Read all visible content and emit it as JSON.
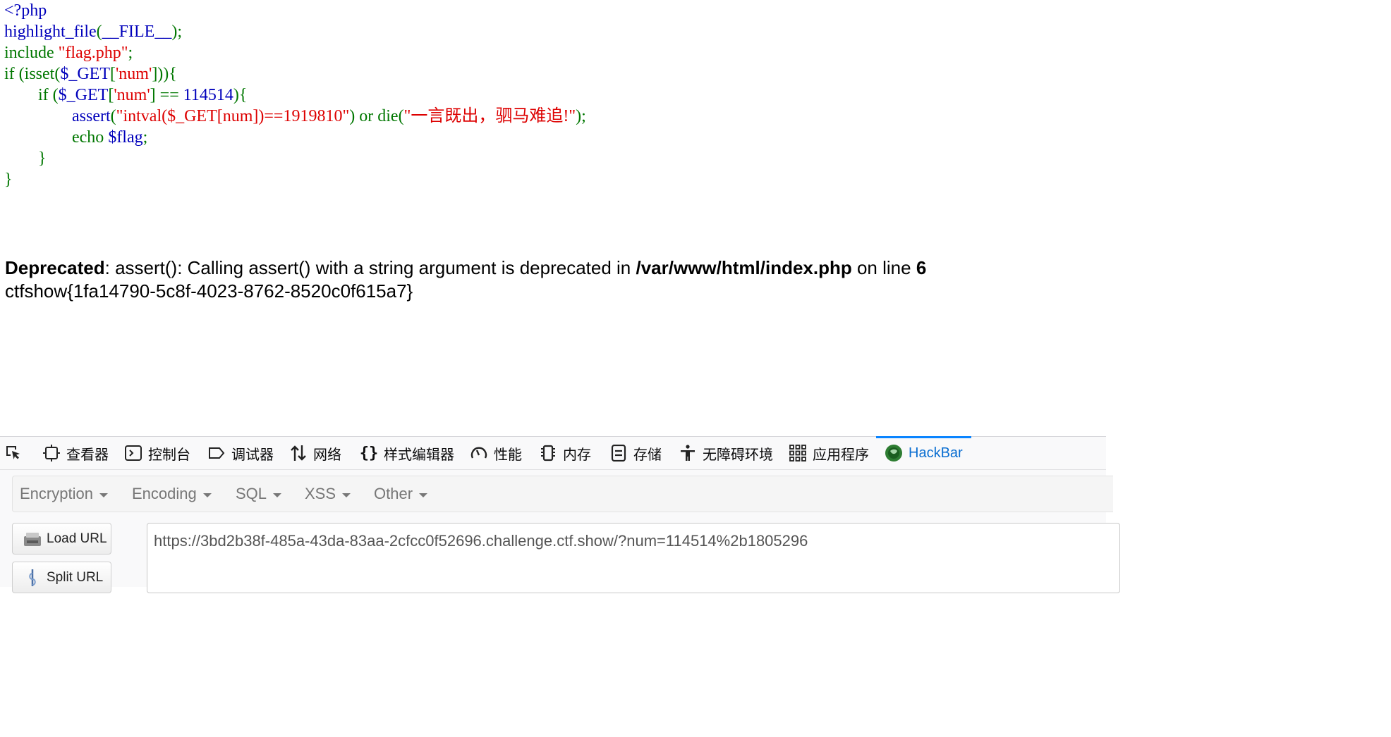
{
  "source_code": {
    "lines": [
      [
        {
          "t": "<?php",
          "c": "d"
        }
      ],
      [
        {
          "t": "highlight_file",
          "c": "d"
        },
        {
          "t": "(",
          "c": "k"
        },
        {
          "t": "__FILE__",
          "c": "d"
        },
        {
          "t": ");",
          "c": "k"
        }
      ],
      [
        {
          "t": "include ",
          "c": "k"
        },
        {
          "t": "\"flag.php\"",
          "c": "s"
        },
        {
          "t": ";",
          "c": "k"
        }
      ],
      [
        {
          "t": "if ",
          "c": "k"
        },
        {
          "t": "(isset(",
          "c": "k"
        },
        {
          "t": "$_GET",
          "c": "d"
        },
        {
          "t": "[",
          "c": "k"
        },
        {
          "t": "'num'",
          "c": "s"
        },
        {
          "t": "])){",
          "c": "k"
        }
      ],
      [
        {
          "t": "        if ",
          "c": "k"
        },
        {
          "t": "(",
          "c": "k"
        },
        {
          "t": "$_GET",
          "c": "d"
        },
        {
          "t": "[",
          "c": "k"
        },
        {
          "t": "'num'",
          "c": "s"
        },
        {
          "t": "] ",
          "c": "k"
        },
        {
          "t": "== ",
          "c": "k"
        },
        {
          "t": "114514",
          "c": "d"
        },
        {
          "t": "){",
          "c": "k"
        }
      ],
      [
        {
          "t": "                ",
          "c": "k"
        },
        {
          "t": "assert",
          "c": "d"
        },
        {
          "t": "(",
          "c": "k"
        },
        {
          "t": "\"intval($_GET[num])==1919810\"",
          "c": "s"
        },
        {
          "t": ") ",
          "c": "k"
        },
        {
          "t": "or ",
          "c": "k"
        },
        {
          "t": "die(",
          "c": "k"
        },
        {
          "t": "\"一言既出，驷马难追!\"",
          "c": "s"
        },
        {
          "t": ");",
          "c": "k"
        }
      ],
      [
        {
          "t": "                echo ",
          "c": "k"
        },
        {
          "t": "$flag",
          "c": "d"
        },
        {
          "t": ";",
          "c": "k"
        }
      ],
      [
        {
          "t": "        }",
          "c": "k"
        }
      ],
      [
        {
          "t": "}",
          "c": "k"
        }
      ]
    ]
  },
  "output": {
    "deprecated_label": "Deprecated",
    "deprecated_msg": ": assert(): Calling assert() with a string argument is deprecated in ",
    "file_path": "/var/www/html/index.php",
    "on_line_text": " on line ",
    "line_number": "6",
    "flag": "ctfshow{1fa14790-5c8f-4023-8762-8520c0f615a7}"
  },
  "devtools": {
    "tabs": [
      {
        "label": "",
        "icon": "pick-element-icon"
      },
      {
        "label": "查看器",
        "icon": "inspector-icon"
      },
      {
        "label": "控制台",
        "icon": "console-icon"
      },
      {
        "label": "调试器",
        "icon": "debugger-icon"
      },
      {
        "label": "网络",
        "icon": "network-icon"
      },
      {
        "label": "样式编辑器",
        "icon": "style-editor-icon"
      },
      {
        "label": "性能",
        "icon": "performance-icon"
      },
      {
        "label": "内存",
        "icon": "memory-icon"
      },
      {
        "label": "存储",
        "icon": "storage-icon"
      },
      {
        "label": "无障碍环境",
        "icon": "accessibility-icon"
      },
      {
        "label": "应用程序",
        "icon": "application-icon"
      },
      {
        "label": "HackBar",
        "icon": "hackbar-icon",
        "active": true
      }
    ],
    "accent_color": "#0a84ff"
  },
  "hackbar": {
    "menu": [
      "Encryption",
      "Encoding",
      "SQL",
      "XSS",
      "Other"
    ],
    "load_url_label": "Load URL",
    "split_url_label": "Split URL",
    "url_value": "https://3bd2b38f-485a-43da-83aa-2cfcc0f52696.challenge.ctf.show/?num=114514%2b1805296"
  }
}
